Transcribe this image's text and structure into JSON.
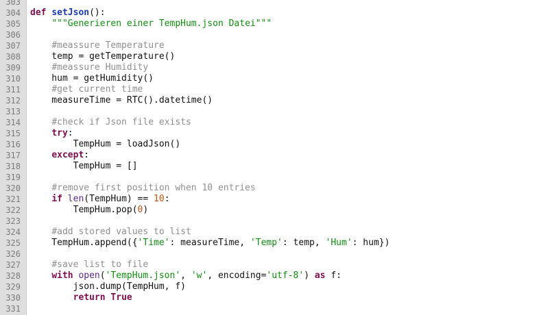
{
  "editor": {
    "lines": [
      {
        "num": "303",
        "tokens": []
      },
      {
        "num": "304",
        "tokens": [
          {
            "t": "def",
            "c": "kw"
          },
          {
            "t": " ",
            "c": ""
          },
          {
            "t": "setJson",
            "c": "fn"
          },
          {
            "t": "():",
            "c": ""
          }
        ]
      },
      {
        "num": "305",
        "tokens": [
          {
            "t": "    ",
            "c": ""
          },
          {
            "t": "\"\"\"Generieren einer TempHum.json Datei\"\"\"",
            "c": "str"
          }
        ]
      },
      {
        "num": "306",
        "tokens": []
      },
      {
        "num": "307",
        "tokens": [
          {
            "t": "    ",
            "c": ""
          },
          {
            "t": "#meassure Temperature",
            "c": "cm"
          }
        ]
      },
      {
        "num": "308",
        "tokens": [
          {
            "t": "    temp = getTemperature()",
            "c": ""
          }
        ]
      },
      {
        "num": "309",
        "tokens": [
          {
            "t": "    ",
            "c": ""
          },
          {
            "t": "#meassure Humidity",
            "c": "cm"
          }
        ]
      },
      {
        "num": "310",
        "tokens": [
          {
            "t": "    hum = getHumidity()",
            "c": ""
          }
        ]
      },
      {
        "num": "311",
        "tokens": [
          {
            "t": "    ",
            "c": ""
          },
          {
            "t": "#get current time",
            "c": "cm"
          }
        ]
      },
      {
        "num": "312",
        "tokens": [
          {
            "t": "    measureTime = RTC().datetime()",
            "c": ""
          }
        ]
      },
      {
        "num": "313",
        "tokens": []
      },
      {
        "num": "314",
        "tokens": [
          {
            "t": "    ",
            "c": ""
          },
          {
            "t": "#check if Json file exists",
            "c": "cm"
          }
        ]
      },
      {
        "num": "315",
        "tokens": [
          {
            "t": "    ",
            "c": ""
          },
          {
            "t": "try",
            "c": "kw"
          },
          {
            "t": ":",
            "c": ""
          }
        ]
      },
      {
        "num": "316",
        "tokens": [
          {
            "t": "        TempHum = loadJson()",
            "c": ""
          }
        ]
      },
      {
        "num": "317",
        "tokens": [
          {
            "t": "    ",
            "c": ""
          },
          {
            "t": "except",
            "c": "kw"
          },
          {
            "t": ":",
            "c": ""
          }
        ]
      },
      {
        "num": "318",
        "tokens": [
          {
            "t": "        TempHum = []",
            "c": ""
          }
        ]
      },
      {
        "num": "319",
        "tokens": []
      },
      {
        "num": "320",
        "tokens": [
          {
            "t": "    ",
            "c": ""
          },
          {
            "t": "#remove first position when 10 entries",
            "c": "cm"
          }
        ]
      },
      {
        "num": "321",
        "tokens": [
          {
            "t": "    ",
            "c": ""
          },
          {
            "t": "if",
            "c": "kw"
          },
          {
            "t": " ",
            "c": ""
          },
          {
            "t": "len",
            "c": "bi"
          },
          {
            "t": "(TempHum) == ",
            "c": ""
          },
          {
            "t": "10",
            "c": "num"
          },
          {
            "t": ":",
            "c": ""
          }
        ]
      },
      {
        "num": "322",
        "tokens": [
          {
            "t": "        TempHum.pop(",
            "c": ""
          },
          {
            "t": "0",
            "c": "num"
          },
          {
            "t": ")",
            "c": ""
          }
        ]
      },
      {
        "num": "323",
        "tokens": []
      },
      {
        "num": "324",
        "tokens": [
          {
            "t": "    ",
            "c": ""
          },
          {
            "t": "#add stored values to list",
            "c": "cm"
          }
        ]
      },
      {
        "num": "325",
        "tokens": [
          {
            "t": "    TempHum.append({",
            "c": ""
          },
          {
            "t": "'Time'",
            "c": "str"
          },
          {
            "t": ": measureTime, ",
            "c": ""
          },
          {
            "t": "'Temp'",
            "c": "str"
          },
          {
            "t": ": temp, ",
            "c": ""
          },
          {
            "t": "'Hum'",
            "c": "str"
          },
          {
            "t": ": hum})",
            "c": ""
          }
        ]
      },
      {
        "num": "326",
        "tokens": []
      },
      {
        "num": "327",
        "tokens": [
          {
            "t": "    ",
            "c": ""
          },
          {
            "t": "#save list to file",
            "c": "cm"
          }
        ]
      },
      {
        "num": "328",
        "tokens": [
          {
            "t": "    ",
            "c": ""
          },
          {
            "t": "with",
            "c": "kw"
          },
          {
            "t": " ",
            "c": ""
          },
          {
            "t": "open",
            "c": "bi"
          },
          {
            "t": "(",
            "c": ""
          },
          {
            "t": "'TempHum.json'",
            "c": "str"
          },
          {
            "t": ", ",
            "c": ""
          },
          {
            "t": "'w'",
            "c": "str"
          },
          {
            "t": ", encoding=",
            "c": ""
          },
          {
            "t": "'utf-8'",
            "c": "str"
          },
          {
            "t": ") ",
            "c": ""
          },
          {
            "t": "as",
            "c": "kw"
          },
          {
            "t": " f:",
            "c": ""
          }
        ]
      },
      {
        "num": "329",
        "tokens": [
          {
            "t": "        json.dump(TempHum, f)",
            "c": ""
          }
        ]
      },
      {
        "num": "330",
        "tokens": [
          {
            "t": "        ",
            "c": ""
          },
          {
            "t": "return",
            "c": "kw"
          },
          {
            "t": " ",
            "c": ""
          },
          {
            "t": "True",
            "c": "kw"
          }
        ]
      },
      {
        "num": "331",
        "tokens": []
      }
    ]
  }
}
